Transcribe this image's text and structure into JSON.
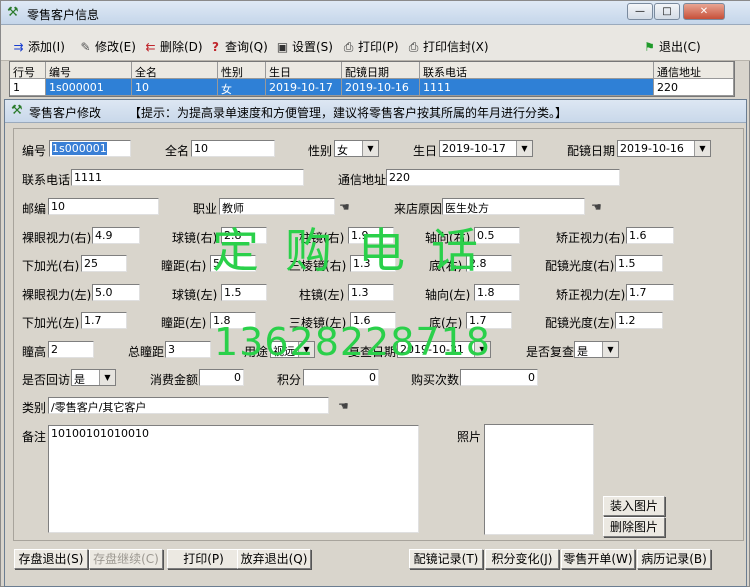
{
  "window": {
    "title": "零售客户信息",
    "controls": {
      "min": "—",
      "max": "□",
      "close": "✕"
    }
  },
  "toolbar": {
    "add": "添加(I)",
    "edit": "修改(E)",
    "delete": "删除(D)",
    "query": "查询(Q)",
    "settings": "设置(S)",
    "print": "打印(P)",
    "print_envelope": "打印信封(X)",
    "exit": "退出(C)"
  },
  "grid": {
    "headers": [
      "行号",
      "编号",
      "全名",
      "性别",
      "生日",
      "配镜日期",
      "联系电话",
      "通信地址"
    ],
    "row": [
      "1",
      "1s000001",
      "10",
      "女",
      "2019-10-17",
      "2019-10-16",
      "1111",
      "220"
    ]
  },
  "dialog": {
    "title": "零售客户修改",
    "hint": "【提示：为提高录单速度和方便管理，建议将零售客户按其所属的年月进行分类。】",
    "labels": {
      "code": "编号",
      "name": "全名",
      "gender": "性别",
      "birthday": "生日",
      "fit_date": "配镜日期",
      "phone": "联系电话",
      "address": "通信地址",
      "zip": "邮编",
      "job": "职业",
      "source": "来店原因",
      "r_naked": "裸眼视力(右)",
      "r_sph": "球镜(右)",
      "r_cyl": "柱镜(右)",
      "r_axis": "轴向(右)",
      "r_corr": "矫正视力(右)",
      "r_add": "下加光(右)",
      "r_pd": "瞳距(右)",
      "r_prism": "三棱镜(右)",
      "r_base": "底(右)",
      "r_power": "配镜光度(右)",
      "l_naked": "裸眼视力(左)",
      "l_sph": "球镜(左)",
      "l_cyl": "柱镜(左)",
      "l_axis": "轴向(左)",
      "l_corr": "矫正视力(左)",
      "l_add": "下加光(左)",
      "l_pd": "瞳距(左)",
      "l_prism": "三棱镜(左)",
      "l_base": "底(左)",
      "l_power": "配镜光度(左)",
      "pupil_h": "瞳高",
      "total_pd": "总瞳距",
      "usage": "用途",
      "recheck_date": "复查日期",
      "recheck": "是否复查",
      "revisit": "是否回访",
      "amount": "消费金额",
      "points": "积分",
      "buy_count": "购买次数",
      "category": "类别",
      "remark": "备注",
      "photo": "照片"
    },
    "values": {
      "code": "1s000001",
      "name": "10",
      "gender": "女",
      "birthday": "2019-10-17",
      "fit_date": "2019-10-16",
      "phone": "1111",
      "address": "220",
      "zip": "10",
      "job": "教师",
      "source": "医生处方",
      "r_naked": "4.9",
      "r_sph": "2.8",
      "r_cyl": "1.9",
      "r_axis": "0.5",
      "r_corr": "1.6",
      "r_add": "25",
      "r_pd": "5",
      "r_prism": "1.3",
      "r_base": "2.8",
      "r_power": "1.5",
      "l_naked": "5.0",
      "l_sph": "1.5",
      "l_cyl": "1.3",
      "l_axis": "1.8",
      "l_corr": "1.7",
      "l_add": "1.7",
      "l_pd": "1.8",
      "l_prism": "1.6",
      "l_base": "1.7",
      "l_power": "1.2",
      "pupil_h": "2",
      "total_pd": "3",
      "usage": "视远",
      "recheck_date": "2019-10-31",
      "recheck": "是",
      "revisit": "是",
      "amount": "0",
      "points": "0",
      "buy_count": "0",
      "category": "/零售客户/其它客户",
      "remark": "10100101010010"
    },
    "photo_buttons": {
      "load": "装入图片",
      "delete": "删除图片"
    },
    "footer": {
      "save_exit": "存盘退出(S)",
      "save_continue": "存盘继续(C)",
      "print": "打印(P)",
      "discard": "放弃退出(Q)",
      "fit_record": "配镜记录(T)",
      "points_change": "积分变化(J)",
      "retail_order": "零售开单(W)",
      "case_record": "病历记录(B)"
    }
  },
  "watermark": {
    "text": "定购电话",
    "phone": "13628228718"
  },
  "colors": {
    "selection": "#2f80d6",
    "watermark": "#2ad04a"
  }
}
